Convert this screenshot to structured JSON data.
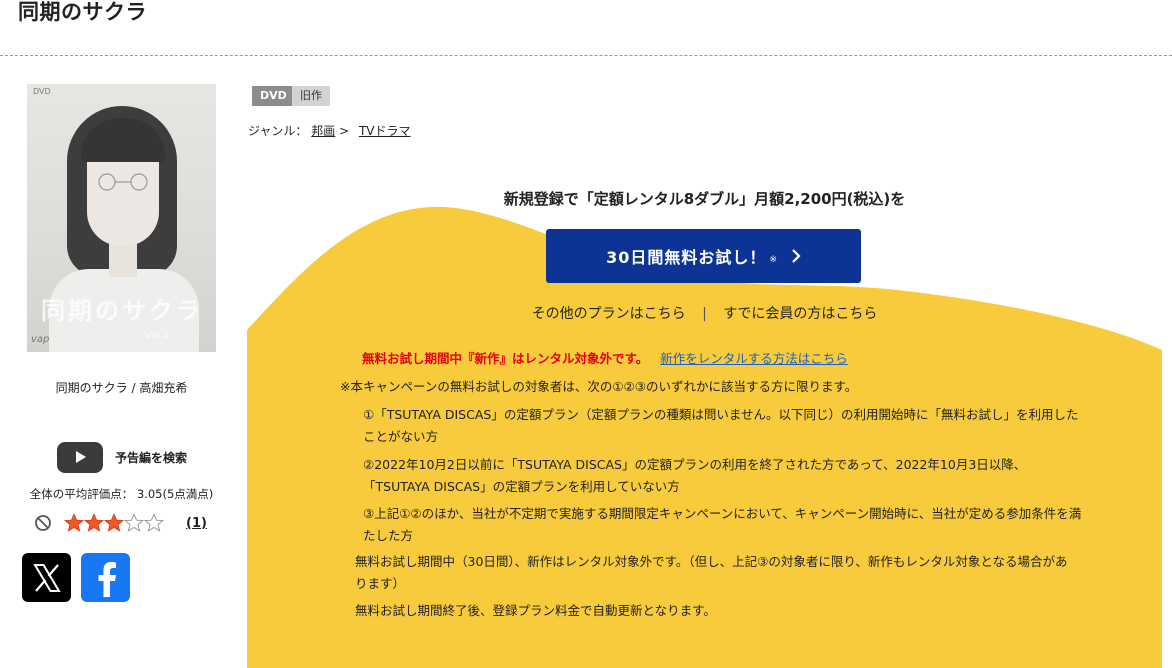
{
  "page": {
    "title": "同期のサクラ"
  },
  "product": {
    "cover_text": {
      "dvd_mark": "DVD",
      "title": "同期のサクラ",
      "vol": "Vol.1",
      "logo": "vap"
    },
    "caption": "同期のサクラ / 高畑充希",
    "trailer_label": "予告編を検索",
    "rating": {
      "summary": "全体の平均評価点： 3.05(5点満点)",
      "stars_value": 3,
      "stars_max": 5,
      "review_count": "(1)"
    },
    "share": {
      "x_icon": "x-logo-icon",
      "fb_icon": "facebook-logo-icon"
    }
  },
  "badges": {
    "format": "DVD",
    "status": "旧作"
  },
  "genre": {
    "label": "ジャンル：",
    "items": [
      "邦画",
      "TVドラマ"
    ],
    "separator": ">"
  },
  "promo": {
    "headline": "新規登録で「定額レンタル8ダブル」月額2,200円(税込)を",
    "cta_label": "30日間無料お試し！",
    "cta_mark": "※",
    "other_plans": "その他のプランはこちら",
    "separator": "|",
    "member_link": "すでに会員の方はこちら",
    "notice_red": "無料お試し期間中『新作』はレンタル対象外です。",
    "notice_link": "新作をレンタルする方法はこちら",
    "terms_intro": "※本キャンペーンの無料お試しの対象者は、次の①②③のいずれかに該当する方に限ります。",
    "conditions": [
      "①「TSUTAYA DISCAS」の定額プラン（定額プランの種類は問いません。以下同じ）の利用開始時に「無料お試し」を利用したことがない方",
      "②2022年10月2日以前に「TSUTAYA DISCAS」の定額プランの利用を終了された方であって、2022年10月3日以降、「TSUTAYA DISCAS」の定額プランを利用していない方",
      "③上記①②のほか、当社が不定期で実施する期間限定キャンペーンにおいて、キャンペーン開始時に、当社が定める参加条件を満たした方"
    ],
    "trial_note": "無料お試し期間中（30日間）、新作はレンタル対象外です。（但し、上記③の対象者に限り、新作もレンタル対象となる場合があります）",
    "renew_note": "無料お試し期間終了後、登録プラン料金で自動更新となります。"
  },
  "colors": {
    "promo_yellow": "#f8cb3c",
    "cta_blue": "#0d3495",
    "notice_red": "#e60012",
    "link_blue": "#1a5fc8",
    "star_fill": "#f0572a"
  }
}
